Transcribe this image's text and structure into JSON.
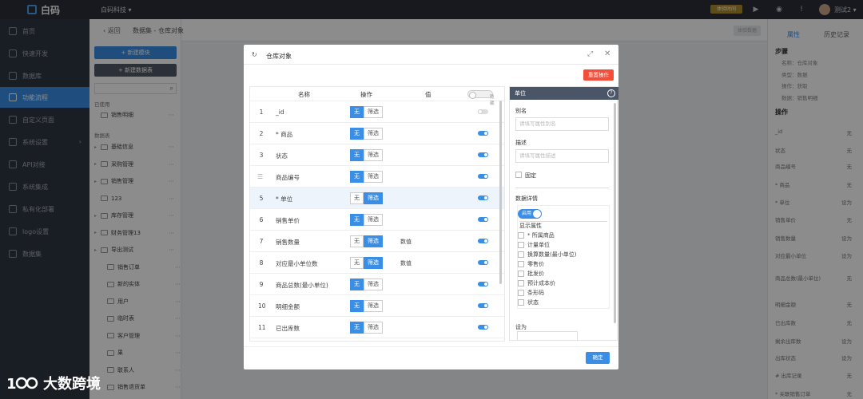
{
  "topbar": {
    "logo": "白码",
    "org": "白码科技 ▾",
    "badge": "体验时间",
    "user": "测试2 ▾"
  },
  "sidebar": {
    "items": [
      {
        "label": "首页"
      },
      {
        "label": "快速开发"
      },
      {
        "label": "数据库"
      },
      {
        "label": "功能流程"
      },
      {
        "label": "自定义页面"
      },
      {
        "label": "系统设置"
      },
      {
        "label": "API对接"
      },
      {
        "label": "系统集成"
      },
      {
        "label": "私有化部署"
      },
      {
        "label": "logo设置"
      },
      {
        "label": "数据集"
      }
    ]
  },
  "panel2": {
    "new_module": "+ 新建模块",
    "new_dataset": "+ 新建数据表",
    "recent_label": "已使用",
    "recent_item": "销售明细",
    "tables_label": "数据表",
    "tree": [
      "基础信息",
      "采购管理",
      "销售管理",
      "123",
      "库存管理",
      "财务管理13",
      "导出测试",
      "销售订单",
      "新的实体",
      "用户",
      "临时表",
      "客户管理",
      "果",
      "联系人",
      "销售退货单"
    ]
  },
  "header": {
    "back": "返回",
    "crumb": "数据集 - 仓库对象",
    "action": "体验数据"
  },
  "rightpanel": {
    "tab_props": "属性",
    "tab_history": "历史记录",
    "step_title": "步骤",
    "meta": [
      "名称：仓库对象",
      "类型：数据",
      "操作：获取",
      "数据：销售明细"
    ],
    "ops_title": "操作",
    "rows": [
      {
        "k": "_id",
        "v": "无"
      },
      {
        "k": "状态",
        "v": "无"
      },
      {
        "k": "商品编号",
        "v": "无"
      },
      {
        "k": "* 商品",
        "v": "无"
      },
      {
        "k": "* 单位",
        "v": "设为"
      },
      {
        "k": "销售单价",
        "v": "无"
      },
      {
        "k": "销售数量",
        "v": "设为"
      },
      {
        "k": "对应最小单位",
        "v": "设为"
      },
      {
        "k": "商品总数(最小单位)",
        "v": "无"
      },
      {
        "k": "明细金额",
        "v": "无"
      },
      {
        "k": "已出库数",
        "v": "无"
      },
      {
        "k": "剩余出库数",
        "v": "设为"
      },
      {
        "k": "出库状态",
        "v": "设为"
      },
      {
        "k": "# 出库记录",
        "v": "无"
      },
      {
        "k": "* 关联销售订单",
        "v": "无"
      }
    ]
  },
  "modal": {
    "title": "仓库对象",
    "reset": "重置操作",
    "columns": {
      "name": "名称",
      "op": "操作",
      "val": "值",
      "hide": "隐藏"
    },
    "rows": [
      {
        "num": "1",
        "name": "_id",
        "none_on": true,
        "value": "",
        "tog": false
      },
      {
        "num": "2",
        "name": "* 商品",
        "none_on": true,
        "value": "",
        "tog": true
      },
      {
        "num": "3",
        "name": "状态",
        "none_on": true,
        "value": "",
        "tog": true
      },
      {
        "num": "",
        "name": "商品编号",
        "none_on": true,
        "value": "",
        "tog": true
      },
      {
        "num": "5",
        "name": "* 单位",
        "none_on": false,
        "value": "",
        "tog": true
      },
      {
        "num": "6",
        "name": "销售单价",
        "none_on": true,
        "value": "",
        "tog": true
      },
      {
        "num": "7",
        "name": "销售数量",
        "none_on": false,
        "value": "数值",
        "tog": true
      },
      {
        "num": "8",
        "name": "对应最小单位数",
        "none_on": false,
        "value": "数值",
        "tog": true
      },
      {
        "num": "9",
        "name": "商品总数(最小单位)",
        "none_on": true,
        "value": "",
        "tog": true
      },
      {
        "num": "10",
        "name": "明细金额",
        "none_on": true,
        "value": "",
        "tog": true
      },
      {
        "num": "11",
        "name": "已出库数",
        "none_on": true,
        "value": "",
        "tog": true
      }
    ],
    "op_none": "无",
    "op_filter": "筛选",
    "confirm": "确定"
  },
  "prop": {
    "title": "单位",
    "alias_label": "别名",
    "alias_placeholder": "请填写属性别名",
    "desc_label": "描述",
    "desc_placeholder": "请填写属性描述",
    "fixed_label": "固定",
    "detail_label": "数据详情",
    "enable_label": "启用",
    "show_attrs": "显示属性",
    "attrs": [
      "* 所属商品",
      "计量单位",
      "换算数量(最小单位)",
      "零售价",
      "批发价",
      "预计成本价",
      "条形码",
      "状态"
    ],
    "set_label": "设为"
  },
  "watermark": "大数跨境"
}
